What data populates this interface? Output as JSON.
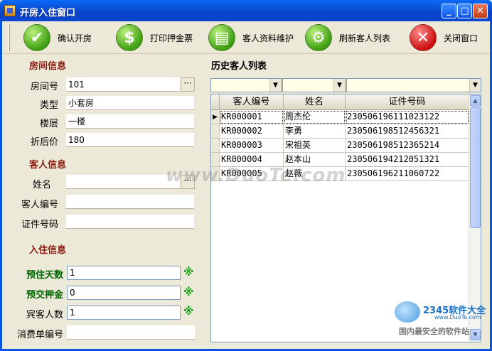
{
  "window": {
    "title": "开房入住窗口"
  },
  "toolbar": {
    "confirm_label": "确认开房",
    "print_label": "打印押金票",
    "maintain_label": "客人资料维护",
    "refresh_label": "刷新客人列表",
    "close_label": "关闭窗口"
  },
  "room": {
    "section_title": "房间信息",
    "number_label": "房间号",
    "number_value": "101",
    "type_label": "类型",
    "type_value": "小套房",
    "floor_label": "楼层",
    "floor_value": "一楼",
    "price_label": "折后价",
    "price_value": "180"
  },
  "guest": {
    "section_title": "客人信息",
    "name_label": "姓名",
    "name_value": "",
    "id_label": "客人编号",
    "id_value": "",
    "cert_label": "证件号码",
    "cert_value": ""
  },
  "checkin": {
    "section_title": "入住信息",
    "days_label": "预住天数",
    "days_value": "1",
    "deposit_label": "预交押金",
    "deposit_value": "0",
    "guests_label": "宾客人数",
    "guests_value": "1",
    "bill_label": "消费单编号",
    "bill_value": "",
    "required_mark": "※"
  },
  "history": {
    "section_title": "历史客人列表",
    "columns": [
      "客人编号",
      "姓名",
      "证件号码"
    ],
    "rows": [
      [
        "KR000001",
        "周杰伦",
        "230506196111023122"
      ],
      [
        "KR000002",
        "李勇",
        "230506198512456321"
      ],
      [
        "KR000003",
        "宋祖英",
        "230506198512365214"
      ],
      [
        "KR000004",
        "赵本山",
        "230506194212051321"
      ],
      [
        "KR000005",
        "赵薇",
        "230506196211060722"
      ]
    ]
  },
  "watermark": {
    "text": "www.DuoTe.com",
    "site": "2345软件大全",
    "site_url": "www.DuoTe.com",
    "slogan": "国内最安全的软件站"
  }
}
